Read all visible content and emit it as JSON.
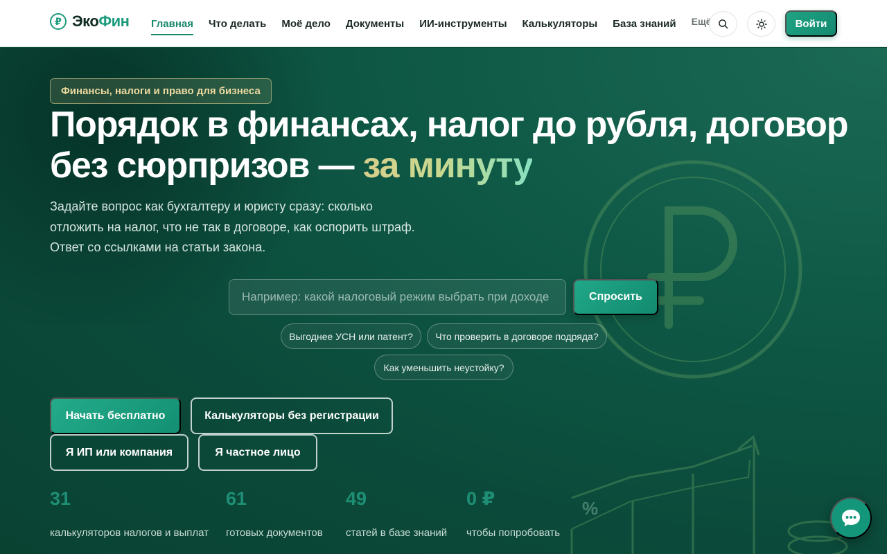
{
  "header": {
    "logo": {
      "prefix": "Эко",
      "accent": "Фин"
    },
    "nav": [
      {
        "label": "Главная",
        "active": true
      },
      {
        "label": "Что делать"
      },
      {
        "label": "Моё дело"
      },
      {
        "label": "Документы"
      },
      {
        "label": "ИИ-инструменты"
      },
      {
        "label": "Калькуляторы"
      },
      {
        "label": "База знаний"
      }
    ],
    "more_label": "Ещё",
    "login_label": "Войти",
    "search_icon": "search-icon",
    "theme_icon": "sun-icon"
  },
  "hero": {
    "badge": "Финансы, налоги и право для бизнеса",
    "title_line1": "Порядок в финансах, налог до рубля, договор",
    "title_line2_prefix": "без сюрпризов — ",
    "title_highlight": "за минуту",
    "subtitle_lines": [
      "Задайте вопрос как бухгалтеру и юристу сразу: сколько",
      "отложить на налог, что не так в договоре, как оспорить штраф.",
      "Ответ со ссылками на статьи закона."
    ],
    "search": {
      "placeholder": "Например: какой налоговый режим выбрать при доходе",
      "button_label": "Спросить"
    },
    "chips": [
      "Выгоднее УСН или патент?",
      "Что проверить в договоре подряда?",
      "Как уменьшить неустойку?"
    ],
    "buttons": {
      "start": "Начать бесплатно",
      "calculators": "Калькуляторы без регистрации",
      "business": "Я ИП или компания",
      "personal": "Я частное лицо"
    },
    "stats": [
      {
        "value": "31",
        "label": "калькуляторов налогов и выплат"
      },
      {
        "value": "61",
        "label": "готовых документов"
      },
      {
        "value": "49",
        "label": "статей в базе знаний"
      },
      {
        "value": "0 ₽",
        "label": "чтобы попробовать"
      }
    ],
    "stat_extra": "%"
  },
  "colors": {
    "accent": "#1b9a7c",
    "hero_bg": "#0b4a3a",
    "badge_text": "#ecd9a0"
  },
  "chat_icon": "chat-bubble-icon"
}
